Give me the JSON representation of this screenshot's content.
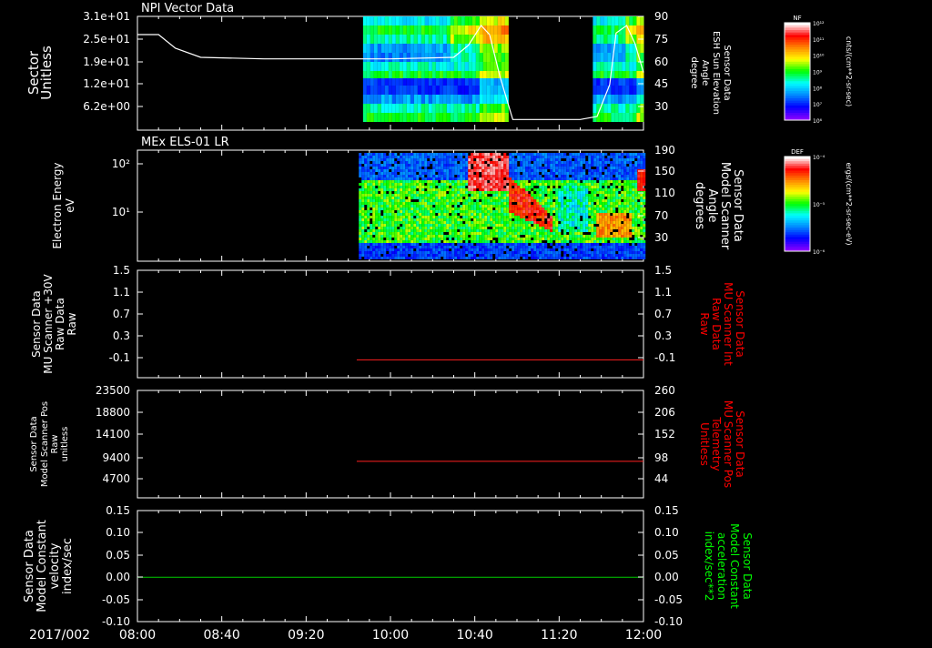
{
  "colors": {
    "background": "#000000",
    "frame": "#ffffff",
    "red_axis": "#ff0000",
    "green_axis": "#00ff00",
    "line_red": "#ff2020",
    "line_green": "#00cc00",
    "colormap": [
      "#ffffff",
      "#ff0000",
      "#ff8800",
      "#ffff00",
      "#00ff00",
      "#00ffff",
      "#0088ff",
      "#0000ff",
      "#8800ff"
    ]
  },
  "time_axis": {
    "date_label": "2017/002",
    "tick_labels": [
      "08:00",
      "08:40",
      "09:20",
      "10:00",
      "10:40",
      "11:20",
      "12:00"
    ],
    "start": "08:00",
    "end": "12:00"
  },
  "chart_data": [
    {
      "type": "heatmap",
      "title": "NPI Vector Data",
      "ylabel": "Sector\nUnitless",
      "y_tick_labels": [
        "3.1e+01",
        "2.5e+01",
        "1.9e+01",
        "1.2e+01",
        "6.2e+00"
      ],
      "right_ylabel": "Sensor Data\nESH Sun Elevation\nAngle\ndegree",
      "right_ylim": [
        15,
        90
      ],
      "right_tick_labels": [
        "90",
        "75",
        "60",
        "45",
        "30"
      ],
      "colorbar": {
        "label": "NF",
        "units": "cnts/(cm**2-sr-sec)",
        "tick_labels": [
          "10¹²",
          "10¹¹",
          "10¹⁰",
          "10⁹",
          "10⁸",
          "10⁷",
          "10⁶"
        ]
      },
      "data_intervals": [
        [
          "09:47",
          "10:56"
        ],
        [
          "11:36",
          "12:00"
        ]
      ],
      "overlay_line": {
        "name": "ESH Sun Elevation Angle",
        "x": [
          "08:00",
          "08:10",
          "08:18",
          "08:30",
          "09:00",
          "09:30",
          "10:00",
          "10:30",
          "10:37",
          "10:43",
          "10:47",
          "10:52",
          "10:58",
          "11:10",
          "11:20",
          "11:30",
          "11:38",
          "11:44",
          "11:47",
          "11:52",
          "11:56",
          "12:00"
        ],
        "y": [
          78,
          78,
          69,
          63,
          62,
          62,
          62,
          63,
          71,
          84,
          78,
          50,
          22,
          22,
          22,
          22,
          24,
          45,
          79,
          84,
          72,
          53
        ]
      }
    },
    {
      "type": "heatmap",
      "title": "MEx ELS-01 LR",
      "ylabel": "Electron Energy\neV",
      "y_tick_labels": [
        "10²",
        "10¹"
      ],
      "right_ylabel": "Sensor Data\nModel Scanner\nAngle\ndegrees",
      "right_ylim": [
        10,
        190
      ],
      "right_tick_labels": [
        "190",
        "150",
        "110",
        "70",
        "30"
      ],
      "colorbar": {
        "label": "DEF",
        "units": "ergs/(cm**2-sr-sec-eV)",
        "tick_labels": [
          "10⁻⁴",
          "10⁻⁵",
          "10⁻⁶"
        ]
      },
      "data_interval": [
        "09:45",
        "12:00"
      ],
      "overlay_line": {
        "name": "Model Scanner Angle",
        "x": [
          "08:00",
          "12:00"
        ],
        "y": [
          10,
          10
        ]
      }
    },
    {
      "type": "line",
      "ylabel": "Sensor Data\nMU Scanner +30V\nRaw Data\nRaw",
      "ylim": [
        -0.3,
        1.5
      ],
      "y_tick_labels": [
        "1.5",
        "1.1",
        "0.7",
        "0.3",
        "-0.1"
      ],
      "right_ylabel": "Sensor Data\nMU Scanner Int\nRaw Data\nRaw",
      "right_tick_labels": [
        "1.5",
        "1.1",
        "0.7",
        "0.3",
        "-0.1"
      ],
      "series": [
        {
          "x": [
            "09:44",
            "12:00"
          ],
          "y": [
            0,
            0
          ]
        }
      ]
    },
    {
      "type": "line",
      "ylabel": "Sensor Data\nModel Scanner Pos\nRaw\nunitless",
      "ylim": [
        0,
        23500
      ],
      "y_tick_labels": [
        "23500",
        "18800",
        "14100",
        "9400",
        "4700"
      ],
      "right_ylabel": "Sensor Data\nMU Scanner Pos\nTelemetry\nUnitless",
      "right_ylim": [
        0,
        260
      ],
      "right_tick_labels": [
        "260",
        "206",
        "152",
        "98",
        "44"
      ],
      "series": [
        {
          "x": [
            "09:44",
            "12:00"
          ],
          "y": [
            8000,
            8000
          ]
        }
      ]
    },
    {
      "type": "line",
      "ylabel": "Sensor Data\nModel Constant\nvelocity\nindex/sec",
      "ylim": [
        -0.1,
        0.15
      ],
      "y_tick_labels": [
        "0.15",
        "0.10",
        "0.05",
        "0.00",
        "-0.05",
        "-0.10"
      ],
      "right_ylabel": "Sensor Data\nModel Constant\nacceleration\nindex/sec**2",
      "right_tick_labels": [
        "0.15",
        "0.10",
        "0.05",
        "0.00",
        "-0.05",
        "-0.10"
      ],
      "series": [
        {
          "x": [
            "08:00",
            "12:00"
          ],
          "y": [
            0,
            0
          ]
        }
      ]
    }
  ]
}
